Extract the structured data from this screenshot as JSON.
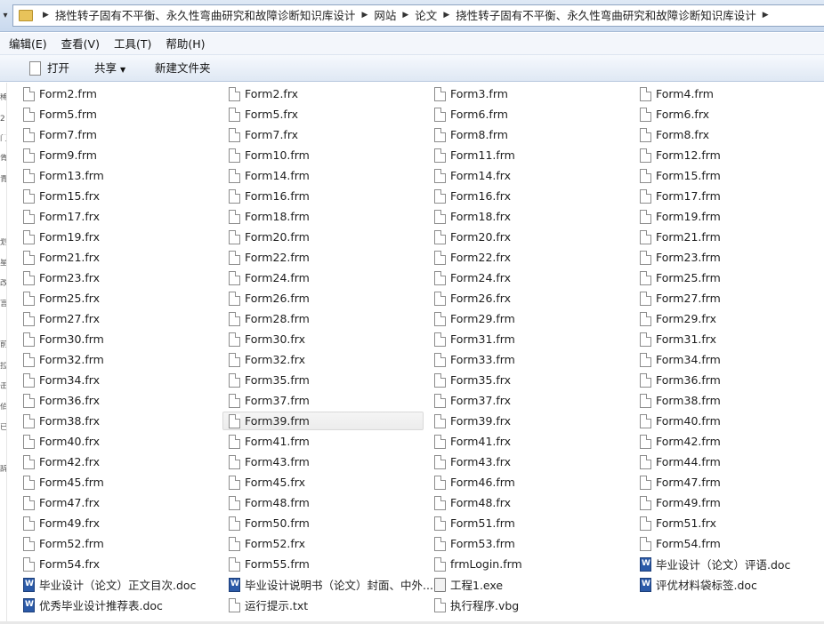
{
  "address": {
    "crumbs": [
      "挠性转子固有不平衡、永久性弯曲研究和故障诊断知识库设计",
      "网站",
      "论文",
      "挠性转子固有不平衡、永久性弯曲研究和故障诊断知识库设计"
    ]
  },
  "menu": [
    "编辑(E)",
    "查看(V)",
    "工具(T)",
    "帮助(H)"
  ],
  "toolbar": {
    "open": "打开",
    "share": "共享",
    "new_folder": "新建文件夹"
  },
  "left_strip_chars": [
    "稀",
    "2",
    "门",
    "胥",
    "青",
    "",
    "划",
    "星",
    "改",
    "言",
    "",
    "前",
    "拉",
    "击",
    "佰",
    "已",
    "",
    "辞"
  ],
  "files": [
    {
      "name": "Form2.frm",
      "type": "file"
    },
    {
      "name": "Form2.frx",
      "type": "file"
    },
    {
      "name": "Form3.frm",
      "type": "file"
    },
    {
      "name": "Form4.frm",
      "type": "file"
    },
    {
      "name": "Form5.frm",
      "type": "file"
    },
    {
      "name": "Form5.frx",
      "type": "file"
    },
    {
      "name": "Form6.frm",
      "type": "file"
    },
    {
      "name": "Form6.frx",
      "type": "file"
    },
    {
      "name": "Form7.frm",
      "type": "file"
    },
    {
      "name": "Form7.frx",
      "type": "file"
    },
    {
      "name": "Form8.frm",
      "type": "file"
    },
    {
      "name": "Form8.frx",
      "type": "file"
    },
    {
      "name": "Form9.frm",
      "type": "file"
    },
    {
      "name": "Form10.frm",
      "type": "file"
    },
    {
      "name": "Form11.frm",
      "type": "file"
    },
    {
      "name": "Form12.frm",
      "type": "file"
    },
    {
      "name": "Form13.frm",
      "type": "file"
    },
    {
      "name": "Form14.frm",
      "type": "file"
    },
    {
      "name": "Form14.frx",
      "type": "file"
    },
    {
      "name": "Form15.frm",
      "type": "file"
    },
    {
      "name": "Form15.frx",
      "type": "file"
    },
    {
      "name": "Form16.frm",
      "type": "file"
    },
    {
      "name": "Form16.frx",
      "type": "file"
    },
    {
      "name": "Form17.frm",
      "type": "file"
    },
    {
      "name": "Form17.frx",
      "type": "file"
    },
    {
      "name": "Form18.frm",
      "type": "file"
    },
    {
      "name": "Form18.frx",
      "type": "file"
    },
    {
      "name": "Form19.frm",
      "type": "file"
    },
    {
      "name": "Form19.frx",
      "type": "file"
    },
    {
      "name": "Form20.frm",
      "type": "file"
    },
    {
      "name": "Form20.frx",
      "type": "file"
    },
    {
      "name": "Form21.frm",
      "type": "file"
    },
    {
      "name": "Form21.frx",
      "type": "file"
    },
    {
      "name": "Form22.frm",
      "type": "file"
    },
    {
      "name": "Form22.frx",
      "type": "file"
    },
    {
      "name": "Form23.frm",
      "type": "file"
    },
    {
      "name": "Form23.frx",
      "type": "file"
    },
    {
      "name": "Form24.frm",
      "type": "file"
    },
    {
      "name": "Form24.frx",
      "type": "file"
    },
    {
      "name": "Form25.frm",
      "type": "file"
    },
    {
      "name": "Form25.frx",
      "type": "file"
    },
    {
      "name": "Form26.frm",
      "type": "file"
    },
    {
      "name": "Form26.frx",
      "type": "file"
    },
    {
      "name": "Form27.frm",
      "type": "file"
    },
    {
      "name": "Form27.frx",
      "type": "file"
    },
    {
      "name": "Form28.frm",
      "type": "file"
    },
    {
      "name": "Form29.frm",
      "type": "file"
    },
    {
      "name": "Form29.frx",
      "type": "file"
    },
    {
      "name": "Form30.frm",
      "type": "file"
    },
    {
      "name": "Form30.frx",
      "type": "file"
    },
    {
      "name": "Form31.frm",
      "type": "file"
    },
    {
      "name": "Form31.frx",
      "type": "file"
    },
    {
      "name": "Form32.frm",
      "type": "file"
    },
    {
      "name": "Form32.frx",
      "type": "file"
    },
    {
      "name": "Form33.frm",
      "type": "file"
    },
    {
      "name": "Form34.frm",
      "type": "file"
    },
    {
      "name": "Form34.frx",
      "type": "file"
    },
    {
      "name": "Form35.frm",
      "type": "file"
    },
    {
      "name": "Form35.frx",
      "type": "file"
    },
    {
      "name": "Form36.frm",
      "type": "file"
    },
    {
      "name": "Form36.frx",
      "type": "file"
    },
    {
      "name": "Form37.frm",
      "type": "file"
    },
    {
      "name": "Form37.frx",
      "type": "file"
    },
    {
      "name": "Form38.frm",
      "type": "file"
    },
    {
      "name": "Form38.frx",
      "type": "file"
    },
    {
      "name": "Form39.frm",
      "type": "file",
      "selected": true
    },
    {
      "name": "Form39.frx",
      "type": "file"
    },
    {
      "name": "Form40.frm",
      "type": "file"
    },
    {
      "name": "Form40.frx",
      "type": "file"
    },
    {
      "name": "Form41.frm",
      "type": "file"
    },
    {
      "name": "Form41.frx",
      "type": "file"
    },
    {
      "name": "Form42.frm",
      "type": "file"
    },
    {
      "name": "Form42.frx",
      "type": "file"
    },
    {
      "name": "Form43.frm",
      "type": "file"
    },
    {
      "name": "Form43.frx",
      "type": "file"
    },
    {
      "name": "Form44.frm",
      "type": "file"
    },
    {
      "name": "Form45.frm",
      "type": "file"
    },
    {
      "name": "Form45.frx",
      "type": "file"
    },
    {
      "name": "Form46.frm",
      "type": "file"
    },
    {
      "name": "Form47.frm",
      "type": "file"
    },
    {
      "name": "Form47.frx",
      "type": "file"
    },
    {
      "name": "Form48.frm",
      "type": "file"
    },
    {
      "name": "Form48.frx",
      "type": "file"
    },
    {
      "name": "Form49.frm",
      "type": "file"
    },
    {
      "name": "Form49.frx",
      "type": "file"
    },
    {
      "name": "Form50.frm",
      "type": "file"
    },
    {
      "name": "Form51.frm",
      "type": "file"
    },
    {
      "name": "Form51.frx",
      "type": "file"
    },
    {
      "name": "Form52.frm",
      "type": "file"
    },
    {
      "name": "Form52.frx",
      "type": "file"
    },
    {
      "name": "Form53.frm",
      "type": "file"
    },
    {
      "name": "Form54.frm",
      "type": "file"
    },
    {
      "name": "Form54.frx",
      "type": "file"
    },
    {
      "name": "Form55.frm",
      "type": "file"
    },
    {
      "name": "frmLogin.frm",
      "type": "file"
    },
    {
      "name": "毕业设计（论文）评语.doc",
      "type": "doc"
    },
    {
      "name": "毕业设计（论文）正文目次.doc",
      "type": "doc"
    },
    {
      "name": "毕业设计说明书（论文）封面、中外...",
      "type": "doc"
    },
    {
      "name": "工程1.exe",
      "type": "exe"
    },
    {
      "name": "评优材料袋标签.doc",
      "type": "doc"
    },
    {
      "name": "优秀毕业设计推荐表.doc",
      "type": "doc"
    },
    {
      "name": "运行提示.txt",
      "type": "txt"
    },
    {
      "name": "执行程序.vbg",
      "type": "file"
    }
  ]
}
